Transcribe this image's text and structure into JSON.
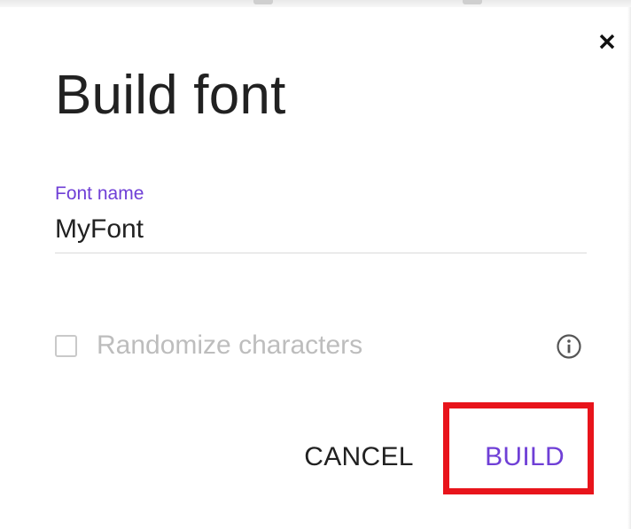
{
  "dialog": {
    "title": "Build font",
    "close_icon": "close-icon",
    "font_name_field": {
      "label": "Font name",
      "value": "MyFont"
    },
    "randomize_checkbox": {
      "label": "Randomize characters",
      "checked": false,
      "disabled": true
    },
    "info_icon": "info-icon",
    "actions": {
      "cancel_label": "CANCEL",
      "build_label": "BUILD"
    }
  },
  "colors": {
    "accent": "#6f3fd6",
    "title_text": "#212121",
    "disabled_text": "#bdbdbd",
    "highlight": "#e8141b"
  }
}
